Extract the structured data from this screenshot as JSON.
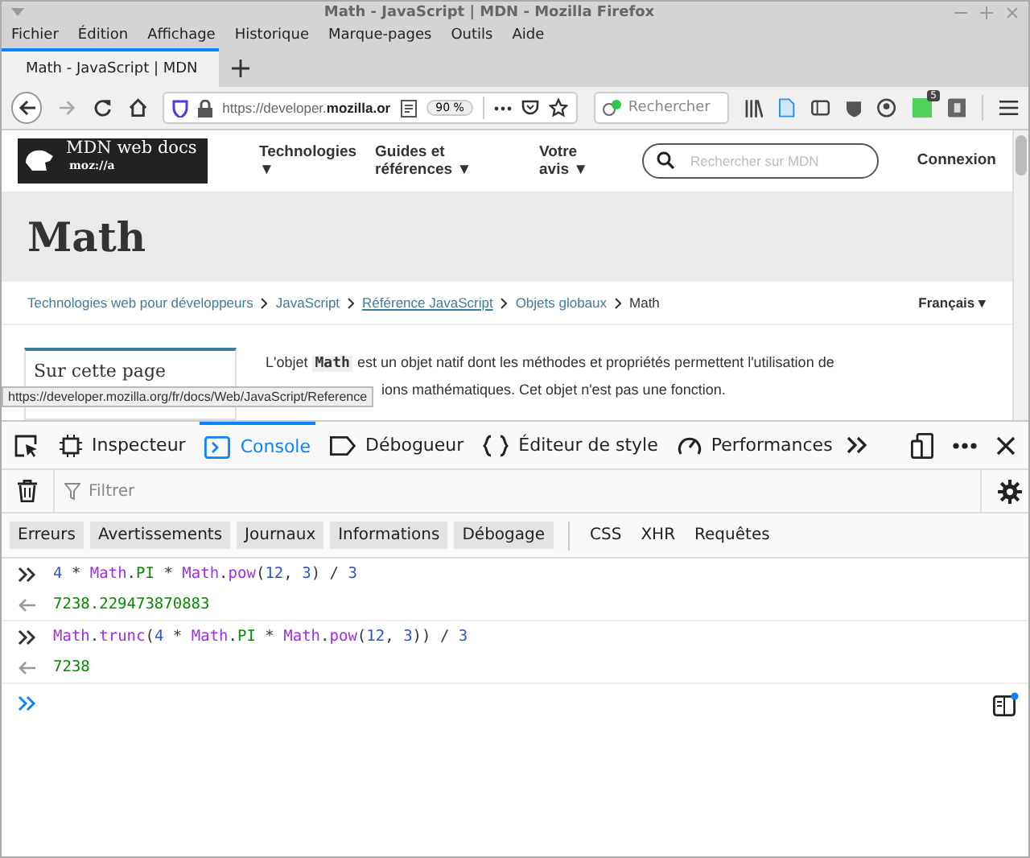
{
  "window": {
    "title": "Math - JavaScript | MDN - Mozilla Firefox"
  },
  "menu": [
    "Fichier",
    "Édition",
    "Affichage",
    "Historique",
    "Marque-pages",
    "Outils",
    "Aide"
  ],
  "tabs": [
    {
      "title": "Math - JavaScript | MDN",
      "selected": true
    }
  ],
  "navbar": {
    "url": "https://developer.**mozilla.or**",
    "zoom": "90 %",
    "search_placeholder": "Rechercher",
    "badge": "5"
  },
  "page": {
    "logo": {
      "name": "MDN web docs",
      "brand": "moz://a"
    },
    "nav": [
      "Technologies ▼",
      "Guides et références ▼",
      "Votre avis ▼"
    ],
    "search_placeholder": "Rechercher sur MDN",
    "login": "Connexion",
    "title": "Math",
    "breadcrumbs": [
      {
        "label": "Technologies web pour développeurs",
        "kind": "link"
      },
      {
        "label": "JavaScript",
        "kind": "link"
      },
      {
        "label": "Référence JavaScript",
        "kind": "hover"
      },
      {
        "label": "Objets globaux",
        "kind": "link"
      },
      {
        "label": "Math",
        "kind": "current"
      }
    ],
    "language": "Français ▾",
    "sidebar_title": "Sur cette page",
    "paragraph": [
      "L'objet **Math** est un objet natif dont les méthodes et propriétés permettent l'utilisation de",
      "ions mathématiques. Cet objet n'est pas une fonction."
    ],
    "status_url": "https://developer.mozilla.org/fr/docs/Web/JavaScript/Reference"
  },
  "devtools": {
    "tabs": [
      {
        "label": "Inspecteur",
        "selected": false
      },
      {
        "label": "Console",
        "selected": true
      },
      {
        "label": "Débogueur",
        "selected": false
      },
      {
        "label": "Éditeur de style",
        "selected": false
      },
      {
        "label": "Performances",
        "selected": false
      }
    ],
    "filter_placeholder": "Filtrer",
    "filters": [
      {
        "label": "Erreurs",
        "on": true
      },
      {
        "label": "Avertissements",
        "on": true
      },
      {
        "label": "Journaux",
        "on": true
      },
      {
        "label": "Informations",
        "on": true
      },
      {
        "label": "Débogage",
        "on": true
      },
      {
        "label": "CSS",
        "on": false
      },
      {
        "label": "XHR",
        "on": false
      },
      {
        "label": "Requêtes",
        "on": false
      }
    ],
    "entries": [
      {
        "kind": "input",
        "tokens": [
          {
            "t": "4",
            "kind": "num"
          },
          {
            "t": " * ",
            "kind": "op"
          },
          {
            "t": "Math",
            "kind": "obj"
          },
          {
            "t": ".",
            "kind": "op"
          },
          {
            "t": "PI",
            "kind": "prop"
          },
          {
            "t": " * ",
            "kind": "op"
          },
          {
            "t": "Math",
            "kind": "obj"
          },
          {
            "t": ".",
            "kind": "op"
          },
          {
            "t": "pow",
            "kind": "obj"
          },
          {
            "t": "(",
            "kind": "op"
          },
          {
            "t": "12",
            "kind": "num"
          },
          {
            "t": ", ",
            "kind": "op"
          },
          {
            "t": "3",
            "kind": "num"
          },
          {
            "t": ") / ",
            "kind": "op"
          },
          {
            "t": "3",
            "kind": "num"
          }
        ]
      },
      {
        "kind": "output",
        "tokens": [
          {
            "t": "7238.229473870883",
            "kind": "result"
          }
        ]
      },
      {
        "kind": "input",
        "tokens": [
          {
            "t": "Math",
            "kind": "obj"
          },
          {
            "t": ".",
            "kind": "op"
          },
          {
            "t": "trunc",
            "kind": "obj"
          },
          {
            "t": "(",
            "kind": "op"
          },
          {
            "t": "4",
            "kind": "num"
          },
          {
            "t": " * ",
            "kind": "op"
          },
          {
            "t": "Math",
            "kind": "obj"
          },
          {
            "t": ".",
            "kind": "op"
          },
          {
            "t": "PI",
            "kind": "prop"
          },
          {
            "t": " * ",
            "kind": "op"
          },
          {
            "t": "Math",
            "kind": "obj"
          },
          {
            "t": ".",
            "kind": "op"
          },
          {
            "t": "pow",
            "kind": "obj"
          },
          {
            "t": "(",
            "kind": "op"
          },
          {
            "t": "12",
            "kind": "num"
          },
          {
            "t": ", ",
            "kind": "op"
          },
          {
            "t": "3",
            "kind": "num"
          },
          {
            "t": ")) / ",
            "kind": "op"
          },
          {
            "t": "3",
            "kind": "num"
          }
        ]
      },
      {
        "kind": "output",
        "tokens": [
          {
            "t": "7238",
            "kind": "result"
          }
        ]
      }
    ]
  }
}
